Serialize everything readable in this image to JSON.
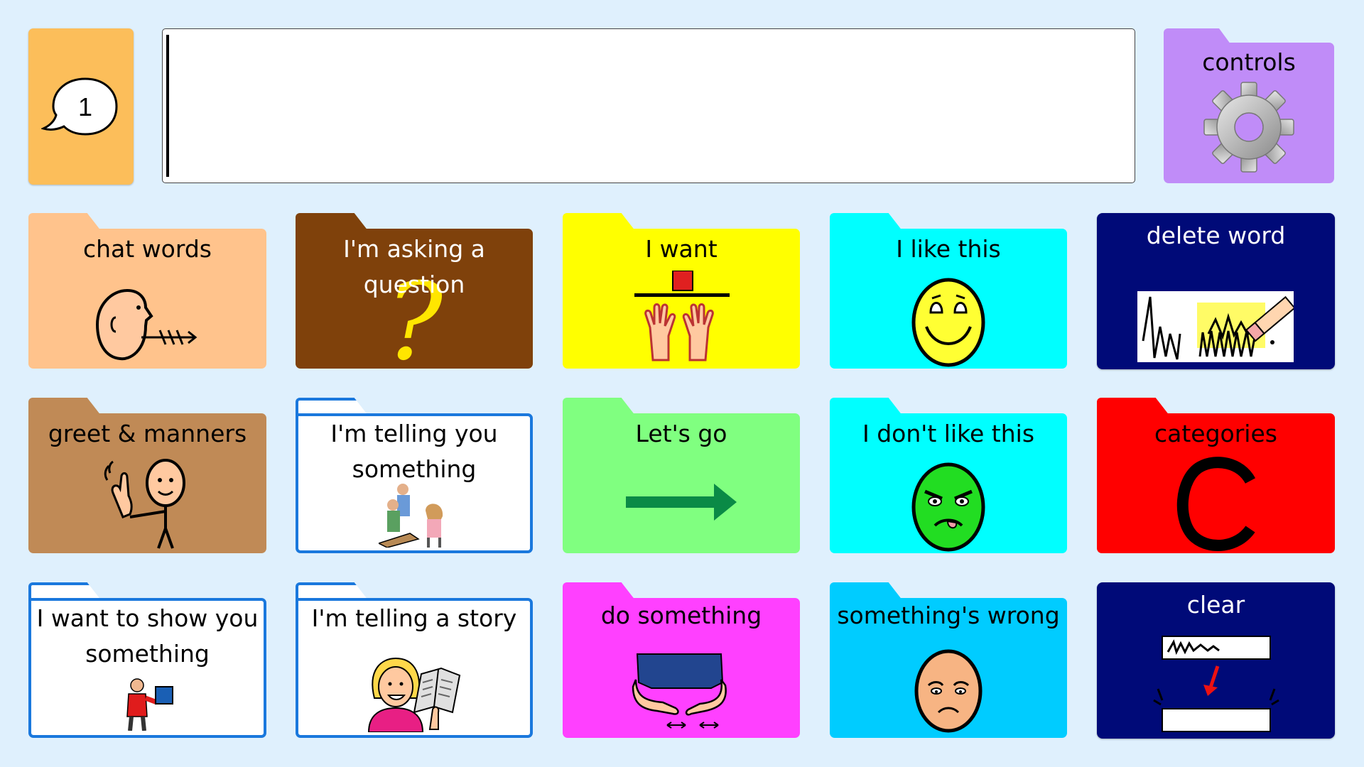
{
  "speak_button": {
    "count": "1"
  },
  "message_bar": {
    "text": ""
  },
  "controls": {
    "label": "controls",
    "color": "#c08cf8"
  },
  "cells": {
    "chat_words": {
      "label": "chat words",
      "color": "#ffc38c"
    },
    "asking_question": {
      "label": "I'm asking a question",
      "color": "#7f410b"
    },
    "i_want": {
      "label": "I want",
      "color": "#ffff00"
    },
    "i_like_this": {
      "label": "I like this",
      "color": "#00ffff"
    },
    "delete_word": {
      "label": "delete word",
      "color": "#000a78"
    },
    "greet_manners": {
      "label": "greet & manners",
      "color": "#c08a56"
    },
    "telling_something": {
      "label": "I'm telling you something",
      "color": "#ffffff"
    },
    "lets_go": {
      "label": "Let's go",
      "color": "#80ff80"
    },
    "dont_like_this": {
      "label": "I don't like this",
      "color": "#00ffff"
    },
    "categories": {
      "label": "categories",
      "color": "#ff0000"
    },
    "show_you_something": {
      "label": "I want to show you something",
      "color": "#ffffff"
    },
    "telling_story": {
      "label": "I'm telling a story",
      "color": "#ffffff"
    },
    "do_something": {
      "label": "do something",
      "color": "#ff40ff"
    },
    "somethings_wrong": {
      "label": "something's wrong",
      "color": "#00ccff"
    },
    "clear": {
      "label": "clear",
      "color": "#000a78"
    }
  }
}
